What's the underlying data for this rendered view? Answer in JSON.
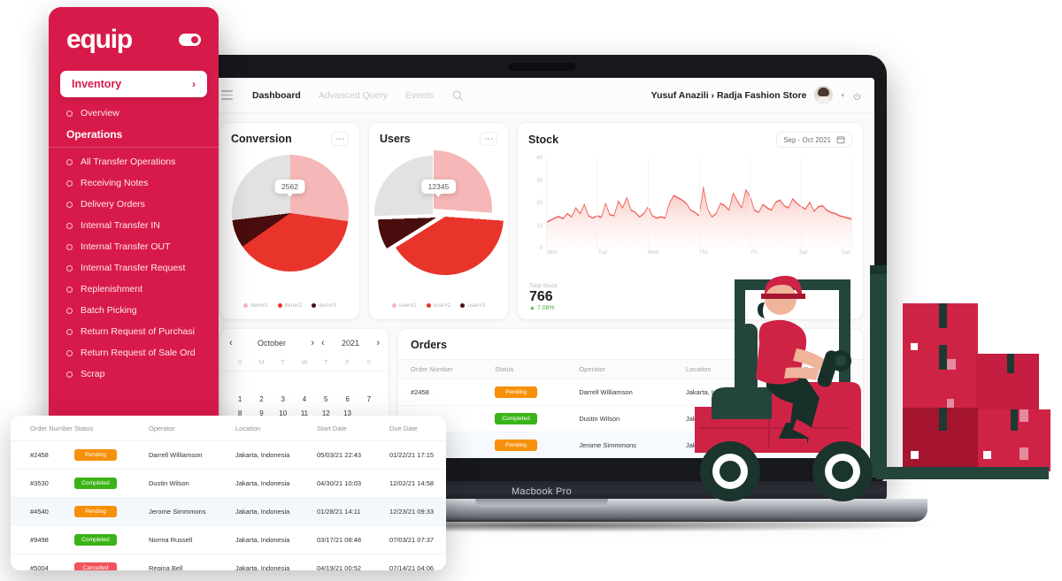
{
  "brand": {
    "logo": "equip",
    "accent": "#d81a4a"
  },
  "sidebar": {
    "active_item": "Inventory",
    "chevron": "›",
    "items_before_section": [
      {
        "label": "Overview"
      }
    ],
    "section_title": "Operations",
    "items": [
      {
        "label": "All Transfer Operations"
      },
      {
        "label": "Receiving Notes"
      },
      {
        "label": "Delivery Orders"
      },
      {
        "label": "Internal Transfer IN"
      },
      {
        "label": "Internal Transfer OUT"
      },
      {
        "label": "Internal Transfer Request"
      },
      {
        "label": "Replenishment"
      },
      {
        "label": "Batch Picking"
      },
      {
        "label": "Return Request of Purchasi"
      },
      {
        "label": "Return Request of Sale Ord"
      },
      {
        "label": "Scrap"
      }
    ]
  },
  "header": {
    "tabs": [
      {
        "label": "Dashboard",
        "active": true
      },
      {
        "label": "Advanced Query",
        "active": false
      },
      {
        "label": "Events",
        "active": false
      }
    ],
    "user_breadcrumb": "Yusuf Anazili › Radja Fashion Store",
    "caret": "▾"
  },
  "laptop": {
    "model_label": "Macbook Pro"
  },
  "cards": {
    "conversion": {
      "title": "Conversion",
      "tooltip_value": "2562",
      "legend": [
        {
          "label": "item#1",
          "color": "#f5b7b7"
        },
        {
          "label": "item#2",
          "color": "#e8342a"
        },
        {
          "label": "item#3",
          "color": "#4a0d0d"
        }
      ]
    },
    "users": {
      "title": "Users",
      "tooltip_value": "12345",
      "legend": [
        {
          "label": "user#1",
          "color": "#f5b7b7"
        },
        {
          "label": "user#2",
          "color": "#e8342a"
        },
        {
          "label": "user#3",
          "color": "#4a0d0d"
        }
      ]
    },
    "stock": {
      "title": "Stock",
      "date_range": "Sep - Oct 2021",
      "total_label": "Total Stock",
      "total_value": "766",
      "change": "▲ 7.08%"
    }
  },
  "calendar": {
    "month": "October",
    "year": "2021",
    "prev": "‹",
    "next": "›",
    "dow": [
      "S",
      "M",
      "T",
      "W",
      "T",
      "F",
      "S"
    ],
    "days": [
      "",
      "",
      "",
      "",
      "",
      "",
      "",
      "1",
      "2",
      "3",
      "4",
      "5",
      "6",
      "7",
      "8",
      "9",
      "10",
      "11",
      "12",
      "13"
    ]
  },
  "orders": {
    "title": "Orders",
    "columns": [
      "Order Number",
      "Status",
      "Operator",
      "Location",
      "Start Date"
    ],
    "rows": [
      {
        "order": "#2458",
        "status": "Pending",
        "status_kind": "pending",
        "operator": "Darrell Williamson",
        "location": "Jakarta, Indonesia",
        "start": "05/03/21 22:43"
      },
      {
        "order": "#3530",
        "status": "Completed",
        "status_kind": "completed",
        "operator": "Dustin Wilson",
        "location": "Jakarta, Indonesia",
        "start": "04/30/21 10:03"
      },
      {
        "order": "#4540",
        "status": "Pending",
        "status_kind": "pending",
        "operator": "Jerome Simmmons",
        "location": "Jakarta, Indonesia",
        "start": "01/28/21 14:11"
      }
    ]
  },
  "float_table": {
    "columns": [
      "Order Number",
      "Status",
      "Operator",
      "Location",
      "Start Date",
      "Due Date"
    ],
    "rows": [
      {
        "order": "#2458",
        "status": "Pending",
        "status_kind": "pending",
        "operator": "Darrell Williamson",
        "location": "Jakarta, Indonesia",
        "start": "05/03/21 22:43",
        "due": "01/22/21 17:15"
      },
      {
        "order": "#3530",
        "status": "Completed",
        "status_kind": "completed",
        "operator": "Dustin Wilson",
        "location": "Jakarta, Indonesia",
        "start": "04/30/21 10:03",
        "due": "12/02/21 14:58"
      },
      {
        "order": "#4540",
        "status": "Pending",
        "status_kind": "pending",
        "operator": "Jerome Simmmons",
        "location": "Jakarta, Indonesia",
        "start": "01/28/21 14:11",
        "due": "12/23/21 09:33"
      },
      {
        "order": "#9498",
        "status": "Completed",
        "status_kind": "completed",
        "operator": "Norma Russell",
        "location": "Jakarta, Indonesia",
        "start": "03/17/21 08:48",
        "due": "07/03/21 07:37"
      },
      {
        "order": "#5004",
        "status": "Cancelled",
        "status_kind": "cancelled",
        "operator": "Regina Bell",
        "location": "Jakarta, Indonesia",
        "start": "04/19/21 00:52",
        "due": "07/14/21 04:06"
      }
    ]
  },
  "chart_data": [
    {
      "type": "pie",
      "title": "Conversion",
      "labels": [
        "item#1",
        "item#2",
        "item#3",
        "remainder"
      ],
      "values": [
        27,
        38,
        8,
        27
      ],
      "colors": [
        "#f5b7b7",
        "#e8342a",
        "#4a0d0d",
        "#e2e2e2"
      ],
      "annotations": [
        "2562"
      ],
      "legend_position": "bottom"
    },
    {
      "type": "pie",
      "title": "Users",
      "labels": [
        "user#1",
        "user#2",
        "user#3",
        "remainder"
      ],
      "values": [
        26,
        40,
        9,
        25
      ],
      "colors": [
        "#f5b7b7",
        "#e8342a",
        "#4a0d0d",
        "#e2e2e2"
      ],
      "annotations": [
        "12345"
      ],
      "legend_position": "bottom",
      "exploded": true
    },
    {
      "type": "area",
      "title": "Stock",
      "subtitle": "Sep - Oct 2021",
      "xlabel": "",
      "ylabel": "",
      "ylim": [
        0,
        40
      ],
      "yticks": [
        0,
        10,
        20,
        30,
        40
      ],
      "categories": [
        "Mon",
        "Tue",
        "Wed",
        "Thu",
        "Fri",
        "Sat",
        "Sun"
      ],
      "grid": true,
      "line_color": "#ee5a52",
      "fill_color": "#fbdedb",
      "values": [
        11.5,
        12.5,
        13.5,
        14.2,
        13.2,
        15.5,
        14.0,
        18.0,
        15.5,
        19.5,
        14.5,
        13.5,
        14.5,
        13.8,
        20.0,
        15.0,
        14.5,
        21.0,
        18.0,
        22.5,
        17.0,
        16.0,
        14.0,
        15.5,
        18.5,
        14.5,
        13.5,
        14.0,
        13.5,
        20.0,
        23.5,
        22.5,
        21.5,
        20.0,
        17.0,
        16.0,
        14.5,
        27.0,
        17.5,
        14.0,
        15.5,
        20.0,
        19.0,
        17.0,
        24.5,
        21.0,
        18.0,
        26.0,
        23.0,
        17.0,
        16.0,
        19.5,
        18.0,
        17.0,
        20.5,
        21.5,
        19.0,
        18.0,
        22.0,
        20.0,
        18.5,
        17.5,
        20.5,
        16.5,
        18.5,
        19.0,
        17.0,
        16.0,
        15.5,
        14.5,
        14.0,
        13.5,
        13.0
      ],
      "total_label": "Total Stock",
      "total_value": 766,
      "change_pct": 7.08
    }
  ]
}
